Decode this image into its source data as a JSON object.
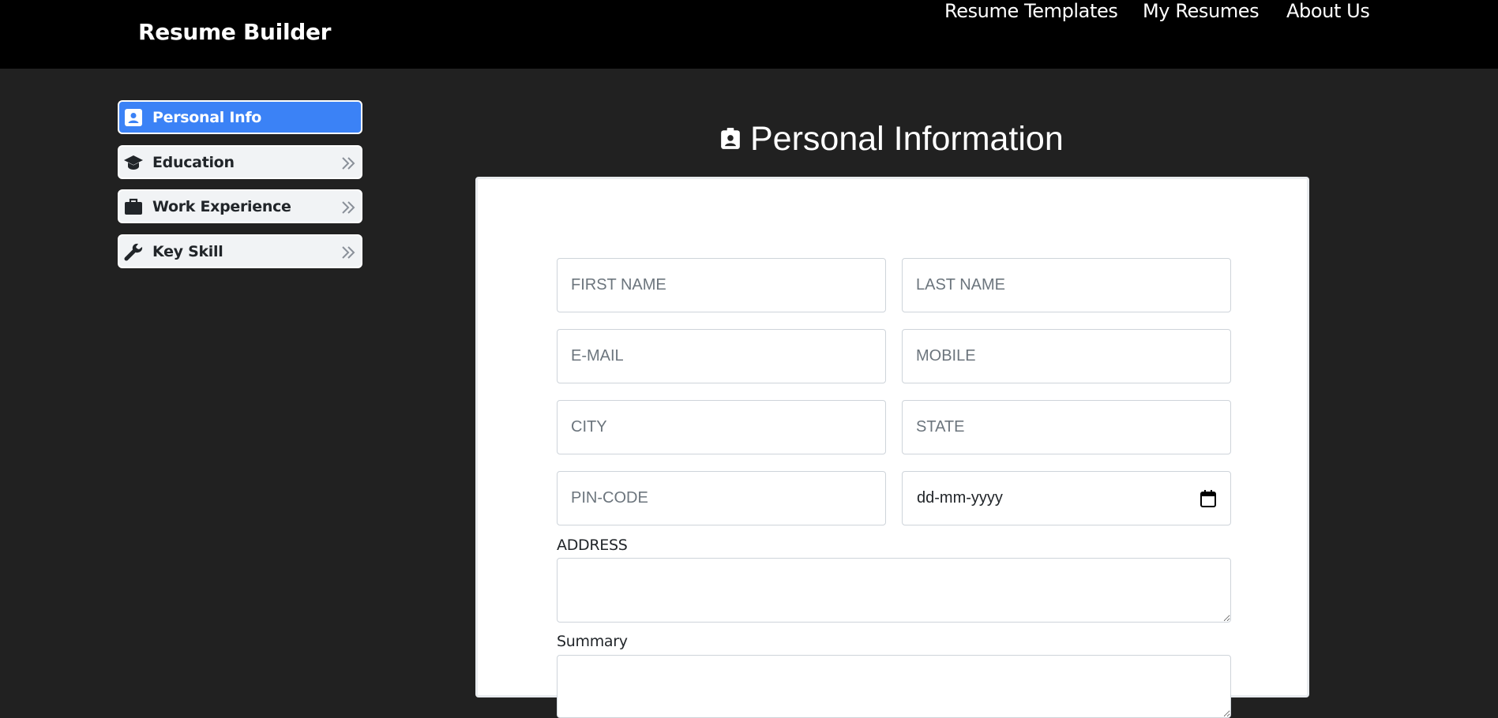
{
  "navbar": {
    "brand": "Resume Builder",
    "links": [
      "Resume Templates",
      "My Resumes",
      "About Us"
    ]
  },
  "sidebar": {
    "items": [
      {
        "label": "Personal Info",
        "icon": "contact-card-icon",
        "active": true
      },
      {
        "label": "Education",
        "icon": "graduation-cap-icon",
        "active": false
      },
      {
        "label": "Work Experience",
        "icon": "briefcase-icon",
        "active": false
      },
      {
        "label": "Key Skill",
        "icon": "wrench-icon",
        "active": false
      }
    ]
  },
  "page": {
    "title": "Personal Information",
    "title_icon": "contact-card-icon"
  },
  "form": {
    "first_name_placeholder": "FIRST NAME",
    "last_name_placeholder": "LAST NAME",
    "email_placeholder": "E-MAIL",
    "mobile_placeholder": "MOBILE",
    "city_placeholder": "CITY",
    "state_placeholder": "STATE",
    "pincode_placeholder": "PIN-CODE",
    "dob_value": "dd-mm-yyyy",
    "address_label": "ADDRESS",
    "summary_label": "Summary"
  },
  "colors": {
    "background": "#212121",
    "navbar": "#000000",
    "accent": "#3b82f6"
  }
}
